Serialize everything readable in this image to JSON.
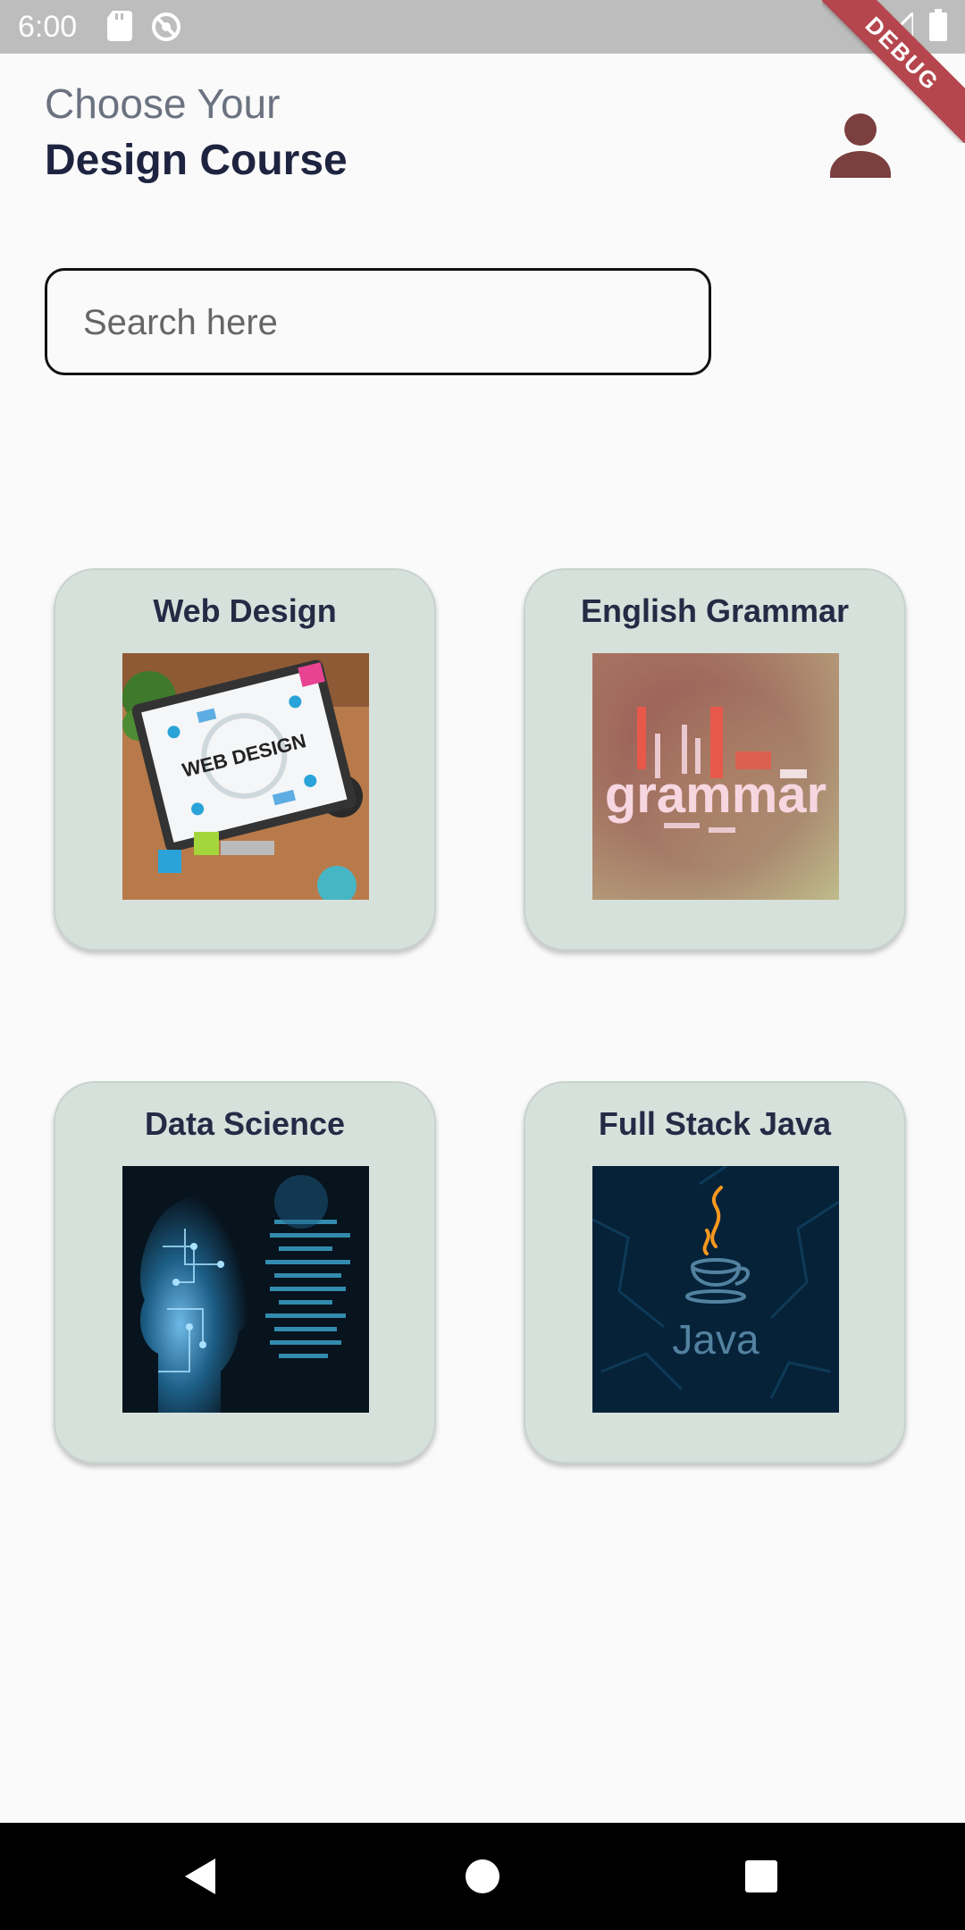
{
  "status_bar": {
    "time": "6:00",
    "icons": [
      "sd-card-icon",
      "sync-icon",
      "wifi-icon",
      "signal-icon",
      "battery-icon"
    ],
    "debug_label": "DEBUG"
  },
  "header": {
    "subtitle": "Choose Your",
    "title": "Design Course",
    "profile_icon": "person-icon"
  },
  "search": {
    "placeholder": "Search here",
    "value": ""
  },
  "courses": [
    {
      "title": "Web Design",
      "image": "web-design-image"
    },
    {
      "title": "English Grammar",
      "image": "grammar-image"
    },
    {
      "title": "Data Science",
      "image": "data-science-image"
    },
    {
      "title": "Full Stack Java",
      "image": "java-image"
    }
  ],
  "course_images": {
    "web_design_text": "WEB DESIGN",
    "grammar_text": "grammar",
    "java_text": "Java"
  },
  "nav_bar": {
    "buttons": [
      "back-icon",
      "home-icon",
      "recents-icon"
    ]
  },
  "colors": {
    "card_bg": "#d7e1dc",
    "title_dark": "#1e2440",
    "subtitle_gray": "#6b7280",
    "profile_icon": "#7b3f3f",
    "debug_ribbon": "#b5464d"
  }
}
